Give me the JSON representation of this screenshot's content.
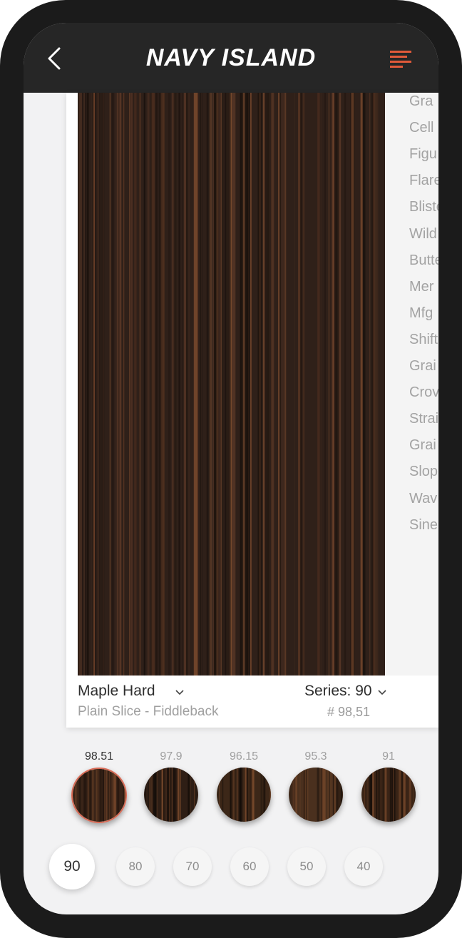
{
  "header": {
    "brand": "NAVY ISLAND",
    "back_icon": "chevron-left-icon",
    "menu_icon": "menu-lines-icon",
    "menu_color": "#e05a3a",
    "bar_color": "#262626"
  },
  "side_list": {
    "items": [
      "Gra",
      "Cell",
      "Figu",
      "Flare",
      "Bliste",
      "Wild",
      "Butte",
      "Mer",
      "Mfg",
      "Shift",
      "Grai",
      "Crov",
      "Strai",
      "Grai",
      "Slop",
      "Wav",
      "Sine"
    ]
  },
  "product": {
    "species": "Maple Hard",
    "cut": "Plain Slice - Fiddleback",
    "series_label": "Series: 90",
    "code": "# 98,51"
  },
  "swatches": [
    {
      "label": "98.51",
      "selected": true,
      "color": "#3a2418"
    },
    {
      "label": "97.9",
      "selected": false,
      "color": "#2e1e15"
    },
    {
      "label": "96.15",
      "selected": false,
      "color": "#3c2718"
    },
    {
      "label": "95.3",
      "selected": false,
      "color": "#4a301e"
    },
    {
      "label": "91",
      "selected": false,
      "color": "#3a2416"
    }
  ],
  "series_buttons": [
    {
      "label": "90",
      "selected": true
    },
    {
      "label": "80",
      "selected": false
    },
    {
      "label": "70",
      "selected": false
    },
    {
      "label": "60",
      "selected": false
    },
    {
      "label": "50",
      "selected": false
    },
    {
      "label": "40",
      "selected": false
    }
  ],
  "accent_color": "#d96a55"
}
